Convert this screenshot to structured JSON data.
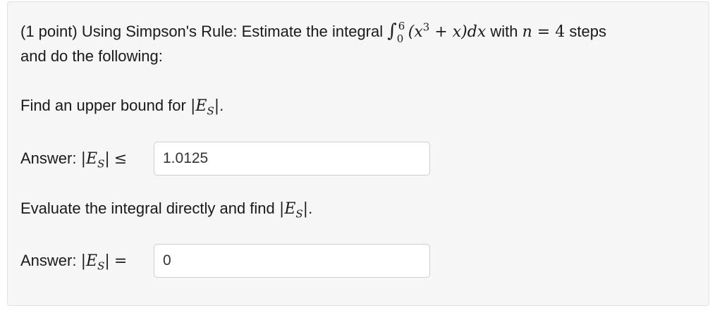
{
  "question": {
    "points_label": "(1 point)",
    "intro_text": "Using Simpson's Rule: Estimate the integral",
    "integral": {
      "symbol": "∫",
      "lower_limit": "0",
      "upper_limit": "6",
      "integrand_open": "(x",
      "exponent": "3",
      "integrand_rest": " + x)",
      "differential": "dx"
    },
    "with_text": "with",
    "n_var": "n",
    "n_equals": " = 4",
    "steps_text": "steps",
    "line2_text": "and do the following:"
  },
  "part1": {
    "prompt": "Find an upper bound for",
    "answer_label": "Answer:",
    "relation": "≤",
    "answer_value": "1.0125"
  },
  "part2": {
    "prompt": "Evaluate the integral directly and find",
    "answer_label": "Answer:",
    "relation": "=",
    "answer_value": "0"
  },
  "error_symbol": {
    "letter": "E",
    "subscript": "S"
  }
}
